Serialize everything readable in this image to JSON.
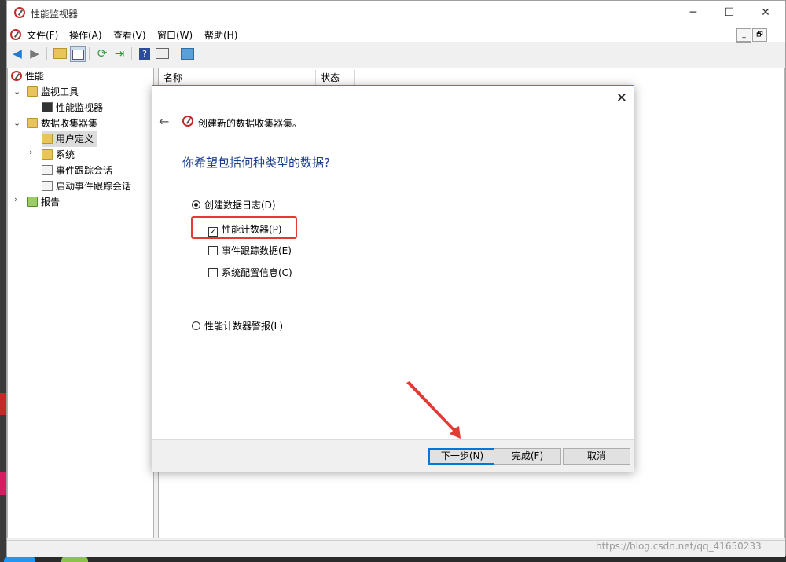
{
  "window": {
    "title": "性能监视器",
    "controls": {
      "minimize": "─",
      "maximize": "☐",
      "close": "✕"
    }
  },
  "menu": [
    "文件(F)",
    "操作(A)",
    "查看(V)",
    "窗口(W)",
    "帮助(H)"
  ],
  "mdi_controls": [
    "_",
    "🗗",
    "✕"
  ],
  "tree": {
    "root": "性能",
    "monitoring_tools": "监视工具",
    "perf_monitor": "性能监视器",
    "data_collector_sets": "数据收集器集",
    "user_defined": "用户定义",
    "system": "系统",
    "event_trace_sessions": "事件跟踪会话",
    "startup_event_trace_sessions": "启动事件跟踪会话",
    "reports": "报告"
  },
  "list": {
    "columns": [
      "名称",
      "状态"
    ]
  },
  "dialog": {
    "title": "创建新的数据收集器集。",
    "question": "你希望包括何种类型的数据?",
    "options": {
      "create_log": {
        "label": "创建数据日志(D)",
        "selected": true
      },
      "perf_counter": {
        "label": "性能计数器(P)",
        "checked": true
      },
      "event_trace": {
        "label": "事件跟踪数据(E)",
        "checked": false
      },
      "sys_config": {
        "label": "系统配置信息(C)",
        "checked": false
      },
      "perf_alert": {
        "label": "性能计数器警报(L)",
        "selected": false
      }
    },
    "buttons": {
      "next": "下一步(N)",
      "finish": "完成(F)",
      "cancel": "取消"
    }
  },
  "watermark": "https://blog.csdn.net/qq_41650233",
  "colors": {
    "highlight_box": "#e53935",
    "arrow": "#e53935",
    "question_text": "#1a3e8c",
    "default_button_border": "#0078d7"
  }
}
